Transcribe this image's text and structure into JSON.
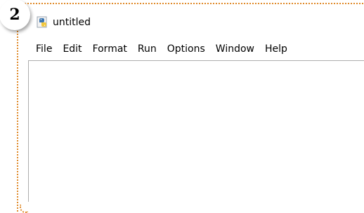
{
  "step": {
    "number": "2"
  },
  "window": {
    "title": "untitled",
    "icon": "python-idle-icon"
  },
  "menubar": {
    "items": [
      "File",
      "Edit",
      "Format",
      "Run",
      "Options",
      "Window",
      "Help"
    ]
  },
  "editor": {
    "content": ""
  },
  "colors": {
    "callout_border": "#e08a2a",
    "editor_border": "#adadad"
  }
}
